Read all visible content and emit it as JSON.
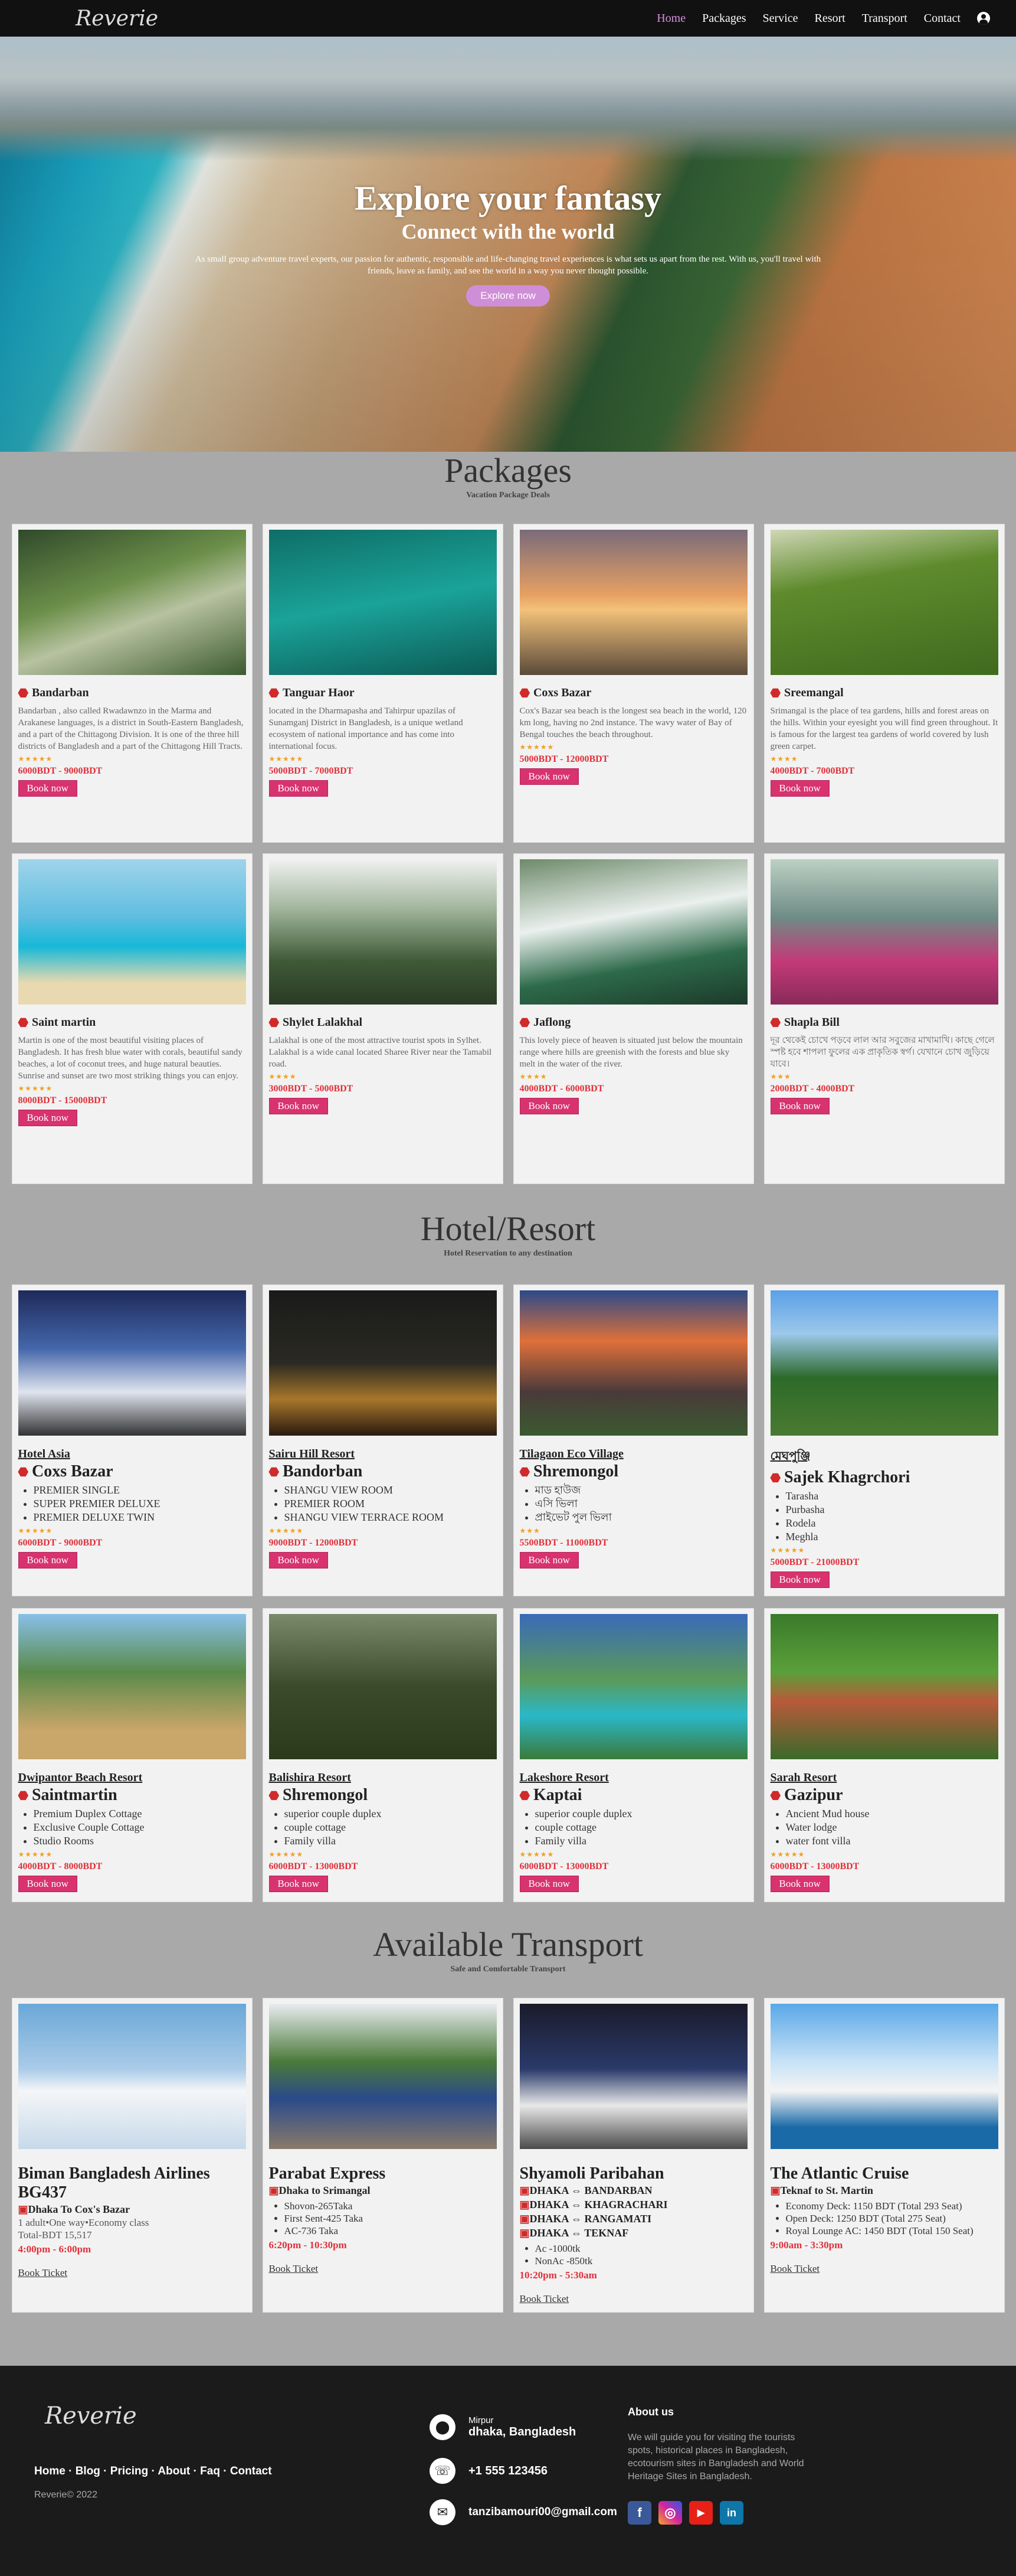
{
  "nav": {
    "logo": "Reverie",
    "links": [
      "Home",
      "Packages",
      "Service",
      "Resort",
      "Transport",
      "Contact"
    ]
  },
  "hero": {
    "title": "Explore your fantasy",
    "subtitle": "Connect with the world",
    "text": "As small group adventure travel experts, our passion for authentic, responsible and life-changing travel experiences is what sets us apart from the rest. With us, you'll travel with friends, leave as family, and see the world in a way you never thought possible.",
    "button": "Explore now"
  },
  "packages": {
    "title": "Packages",
    "subtitle": "Vacation Package Deals",
    "items": [
      {
        "name": "Bandarban",
        "desc": "Bandarban , also called Rwadawnzo in the Marma and Arakanese languages, is a district in South-Eastern Bangladesh, and a part of the Chittagong Division. It is one of the three hill districts of Bangladesh and a part of the Chittagong Hill Tracts.",
        "stars": "★★★★★",
        "price": "6000BDT - 9000BDT",
        "btn": "Book now"
      },
      {
        "name": "Tanguar Haor",
        "desc": "located in the Dharmapasha and Tahirpur upazilas of Sunamganj District in Bangladesh, is a unique wetland ecosystem of national importance and has come into international focus.",
        "stars": "★★★★★",
        "price": "5000BDT - 7000BDT",
        "btn": "Book now"
      },
      {
        "name": "Coxs Bazar",
        "desc": "Cox's Bazar sea beach is the longest sea beach in the world, 120 km long, having no 2nd instance. The wavy water of Bay of Bengal touches the beach throughout.",
        "stars": "★★★★★",
        "price": "5000BDT - 12000BDT",
        "btn": "Book now"
      },
      {
        "name": "Sreemangal",
        "desc": "Srimangal is the place of tea gardens, hills and forest areas on the hills. Within your eyesight you will find green throughout. It is famous for the largest tea gardens of world covered by lush green carpet.",
        "stars": "★★★★",
        "price": "4000BDT - 7000BDT",
        "btn": "Book now"
      },
      {
        "name": "Saint martin",
        "desc": "Martin is one of the most beautiful visiting places of Bangladesh. It has fresh blue water with corals, beautiful sandy beaches, a lot of coconut trees, and huge natural beauties. Sunrise and sunset are two most striking things you can enjoy.",
        "stars": "★★★★★",
        "price": "8000BDT - 15000BDT",
        "btn": "Book now"
      },
      {
        "name": "Shylet Lalakhal",
        "desc": "Lalakhal is one of the most attractive tourist spots in Sylhet. Lalakhal is a wide canal located Sharee River near the Tamabil road.",
        "stars": "★★★★",
        "price": "3000BDT - 5000BDT",
        "btn": "Book now"
      },
      {
        "name": "Jaflong",
        "desc": "This lovely piece of heaven is situated just below the mountain range where hills are greenish with the forests and blue sky melt in the water of the river.",
        "stars": "★★★★",
        "price": "4000BDT - 6000BDT",
        "btn": "Book now"
      },
      {
        "name": "Shapla Bill",
        "desc": "দূর থেকেই চোখে পড়বে লাল আর সবুজের মাখামাখি। কাছে গেলে স্পষ্ট হবে শাপলা ফুলের এক প্রাকৃতিক স্বর্গ। যেখানে চোখ জুড়িয়ে যাবে।",
        "stars": "★★★",
        "price": "2000BDT - 4000BDT",
        "btn": "Book now"
      }
    ]
  },
  "hotels": {
    "title": "Hotel/Resort",
    "subtitle": "Hotel Reservation to any destination",
    "items": [
      {
        "name": "Hotel Asia",
        "city": "Coxs Bazar",
        "rooms": [
          "PREMIER SINGLE",
          "SUPER PREMIER DELUXE",
          "PREMIER DELUXE TWIN"
        ],
        "stars": "★★★★★",
        "price": "6000BDT - 9000BDT",
        "btn": "Book now"
      },
      {
        "name": "Sairu Hill Resort",
        "city": "Bandorban",
        "rooms": [
          "SHANGU VIEW ROOM",
          "PREMIER ROOM",
          "SHANGU VIEW TERRACE ROOM"
        ],
        "stars": "★★★★★",
        "price": "9000BDT - 12000BDT",
        "btn": "Book now"
      },
      {
        "name": "Tilagaon Eco Village",
        "city": "Shremongol",
        "rooms": [
          "মাড হাউজ",
          "এসি ভিলা",
          "প্রাইভেট পুল ভিলা"
        ],
        "stars": "★★★",
        "price": "5500BDT - 11000BDT",
        "btn": "Book now"
      },
      {
        "name": "মেঘপুঞ্জি",
        "city": "Sajek Khagrchori",
        "rooms": [
          "Tarasha",
          "Purbasha",
          "Rodela",
          "Meghla"
        ],
        "stars": "★★★★★",
        "price": "5000BDT - 21000BDT",
        "btn": "Book now"
      },
      {
        "name": "Dwipantor Beach Resort",
        "city": "Saintmartin",
        "rooms": [
          "Premium Duplex Cottage",
          "Exclusive Couple Cottage",
          "Studio Rooms"
        ],
        "stars": "★★★★★",
        "price": "4000BDT - 8000BDT",
        "btn": "Book now"
      },
      {
        "name": "Balishira Resort",
        "city": "Shremongol",
        "rooms": [
          "superior couple duplex",
          "couple cottage",
          "Family villa"
        ],
        "stars": "★★★★★",
        "price": "6000BDT - 13000BDT",
        "btn": "Book now"
      },
      {
        "name": "Lakeshore Resort",
        "city": "Kaptai",
        "rooms": [
          "superior couple duplex",
          "couple cottage",
          "Family villa"
        ],
        "stars": "★★★★★",
        "price": "6000BDT - 13000BDT",
        "btn": "Book now"
      },
      {
        "name": "Sarah Resort",
        "city": "Gazipur",
        "rooms": [
          "Ancient Mud house",
          "Water lodge",
          "water font villa"
        ],
        "stars": "★★★★★",
        "price": "6000BDT - 13000BDT",
        "btn": "Book now"
      }
    ]
  },
  "transport": {
    "title": "Available Transport",
    "subtitle": "Safe and Comfortable Transport",
    "items": [
      {
        "name": "Biman Bangladesh Airlines BG437",
        "routes": [
          "Dhaka To Cox's Bazar"
        ],
        "info": [
          "1 adult•One way•Economy class",
          "Total-BDT 15,517"
        ],
        "list": [],
        "time": "4:00pm - 6:00pm",
        "link": "Book Ticket"
      },
      {
        "name": "Parabat Express",
        "routes": [
          "Dhaka to Srimangal"
        ],
        "info": [],
        "list": [
          "Shovon-265Taka",
          "First Sent-425 Taka",
          "AC-736 Taka"
        ],
        "time": "6:20pm - 10:30pm",
        "link": "Book Ticket"
      },
      {
        "name": "Shyamoli Paribahan",
        "routes": [
          "DHAKA ⇔ BANDARBAN",
          "DHAKA ⇔ KHAGRACHARI",
          "DHAKA ⇔ RANGAMATI",
          "DHAKA ⇔ TEKNAF"
        ],
        "info": [],
        "list": [
          "Ac -1000tk",
          "NonAc -850tk"
        ],
        "time": "10:20pm - 5:30am",
        "link": "Book Ticket"
      },
      {
        "name": "The Atlantic Cruise",
        "routes": [
          "Teknaf to St. Martin"
        ],
        "info": [],
        "list": [
          "Economy Deck: 1150 BDT (Total 293 Seat)",
          "Open Deck: 1250 BDT (Total 275 Seat)",
          "Royal Lounge AC: 1450 BDT (Total 150 Seat)"
        ],
        "time": "9:00am - 3:30pm",
        "link": "Book Ticket"
      }
    ]
  },
  "footer": {
    "logo": "Reverie",
    "links": [
      "Home",
      "Blog",
      "Pricing",
      "About",
      "Faq",
      "Contact"
    ],
    "copyright": "Reverie© 2022",
    "address_small": "Mirpur",
    "address": "dhaka, Bangladesh",
    "phone": "+1 555 123456",
    "email": "tanzibamouri00@gmail.com",
    "about_title": "About us",
    "about_text": "We will guide you for visiting the tourists spots, historical places in Bangladesh, ecotourism sites in Bangladesh and World Heritage Sites in Bangladesh.",
    "social": [
      "f",
      "◎",
      "▶",
      "in"
    ]
  }
}
